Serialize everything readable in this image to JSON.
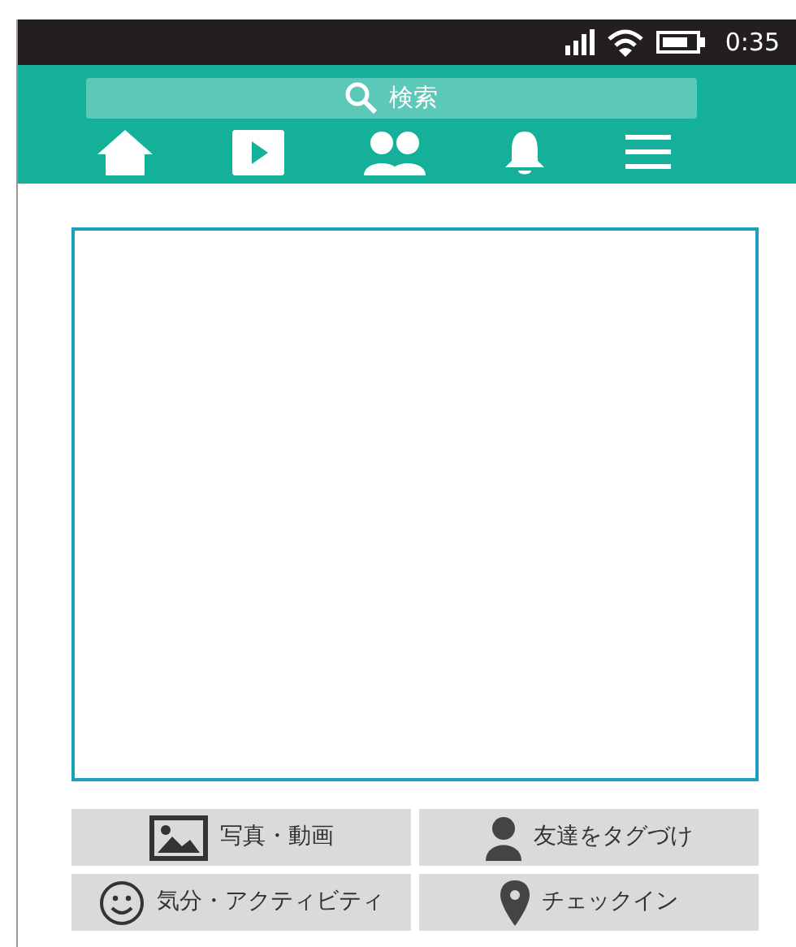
{
  "status_bar": {
    "time": "0:35"
  },
  "search": {
    "placeholder": "検索"
  },
  "nav": [
    {
      "kind": "home"
    },
    {
      "kind": "video"
    },
    {
      "kind": "friends"
    },
    {
      "kind": "bell"
    },
    {
      "kind": "menu"
    }
  ],
  "actions": [
    {
      "kind": "photo",
      "label": "写真・動画"
    },
    {
      "kind": "tag",
      "label": "友達をタグづけ"
    },
    {
      "kind": "feeling",
      "label": "気分・アクティビティ"
    },
    {
      "kind": "checkin",
      "label": "チェックイン"
    }
  ]
}
